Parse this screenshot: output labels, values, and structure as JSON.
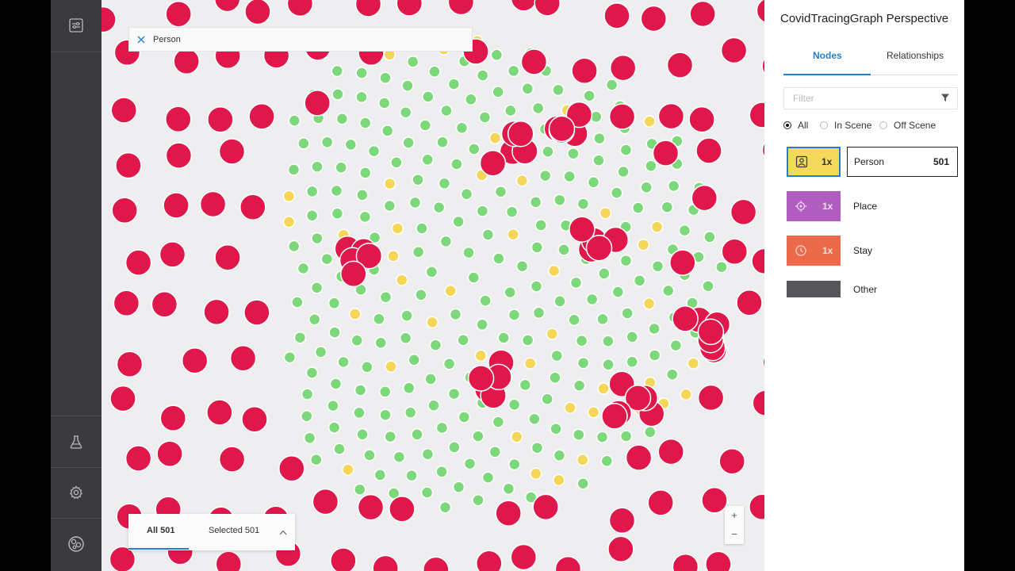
{
  "panel": {
    "title": "CovidTracingGraph Perspective",
    "tabs": [
      "Nodes",
      "Relationships"
    ],
    "filter_placeholder": "Filter",
    "scope_options": [
      "All",
      "In Scene",
      "Off Scene"
    ],
    "categories": [
      {
        "name": "Person",
        "multiplier": "1x",
        "count": "501",
        "color": "#f5d95a",
        "icon": "person-badge-icon"
      },
      {
        "name": "Place",
        "multiplier": "1x",
        "count": "",
        "color": "#b15cc0",
        "icon": "crosshair-icon"
      },
      {
        "name": "Stay",
        "multiplier": "1x",
        "count": "",
        "color": "#ec6a4a",
        "icon": "clock-icon"
      },
      {
        "name": "Other",
        "multiplier": "",
        "count": "",
        "color": "#55555a",
        "icon": ""
      }
    ]
  },
  "search": {
    "value": "Person"
  },
  "bottom_tabs": {
    "all_label": "All 501",
    "selected_label": "Selected 501"
  },
  "zoom": {
    "in": "+",
    "out": "−"
  },
  "colors": {
    "person_node": "#e0174b",
    "place_node": "#7dd87c",
    "stay_node": "#f5d659",
    "sidebar": "#3b3a3f",
    "accent": "#2a7dc9"
  }
}
